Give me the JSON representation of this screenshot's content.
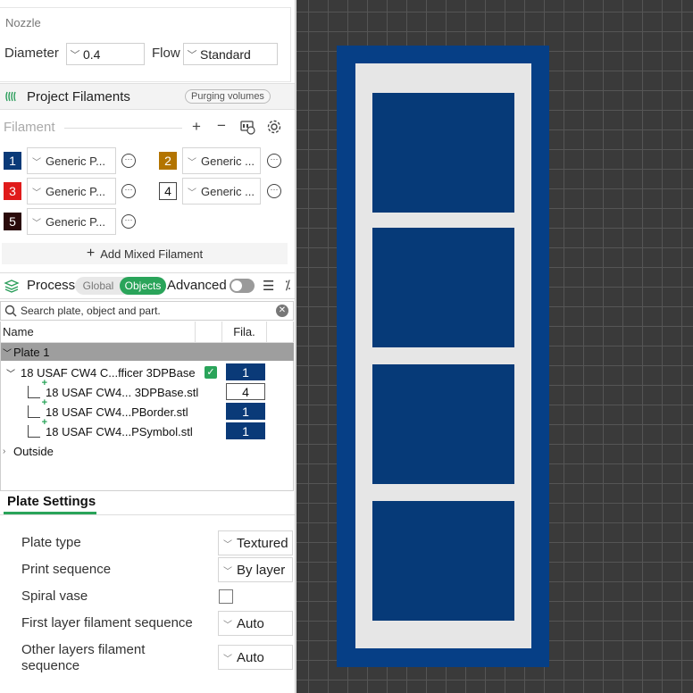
{
  "nozzle": {
    "title": "Nozzle",
    "diameter_label": "Diameter",
    "diameter_value": "0.4",
    "flow_label": "Flow",
    "flow_value": "Standard"
  },
  "project_filaments": {
    "title": "Project Filaments",
    "purging_button": "Purging volumes",
    "filament_label": "Filament",
    "items": [
      {
        "num": "1",
        "color": "#0a3a78",
        "text_color": "#ffffff",
        "name": "Generic P..."
      },
      {
        "num": "2",
        "color": "#b37400",
        "text_color": "#ffffff",
        "name": "Generic ..."
      },
      {
        "num": "3",
        "color": "#e01b1b",
        "text_color": "#ffffff",
        "name": "Generic P..."
      },
      {
        "num": "4",
        "color": "#ffffff",
        "text_color": "#111111",
        "name": "Generic ..."
      },
      {
        "num": "5",
        "color": "#2a0a0a",
        "text_color": "#ffffff",
        "name": "Generic P..."
      }
    ],
    "add_mixed": "Add Mixed Filament"
  },
  "process": {
    "title": "Process",
    "global_label": "Global",
    "objects_label": "Objects",
    "advanced_label": "Advanced",
    "advanced_on": false
  },
  "objects": {
    "search_placeholder": "Search plate, object and part.",
    "col_name": "Name",
    "col_fila": "Fila.",
    "plate": "Plate 1",
    "object": {
      "name": "18 USAF CW4 C...fficer 3DPBase",
      "fila": "1"
    },
    "parts": [
      {
        "name": "18 USAF CW4... 3DPBase.stl",
        "fila": "4",
        "style": "white"
      },
      {
        "name": "18 USAF CW4...PBorder.stl",
        "fila": "1",
        "style": "blue"
      },
      {
        "name": "18 USAF CW4...PSymbol.stl",
        "fila": "1",
        "style": "blue"
      }
    ],
    "outside": "Outside"
  },
  "plate_settings": {
    "tab": "Plate Settings",
    "plate_type_label": "Plate type",
    "plate_type_value": "Textured",
    "print_sequence_label": "Print sequence",
    "print_sequence_value": "By layer",
    "spiral_vase_label": "Spiral vase",
    "spiral_vase_checked": false,
    "first_layer_label": "First layer filament sequence",
    "first_layer_value": "Auto",
    "other_layers_label_1": "Other layers filament",
    "other_layers_label_2": "sequence",
    "other_layers_value": "Auto"
  },
  "colors": {
    "accent": "#2aa45a",
    "filament_blue": "#0a3a78",
    "viewport_bg": "#3a3a3a"
  }
}
